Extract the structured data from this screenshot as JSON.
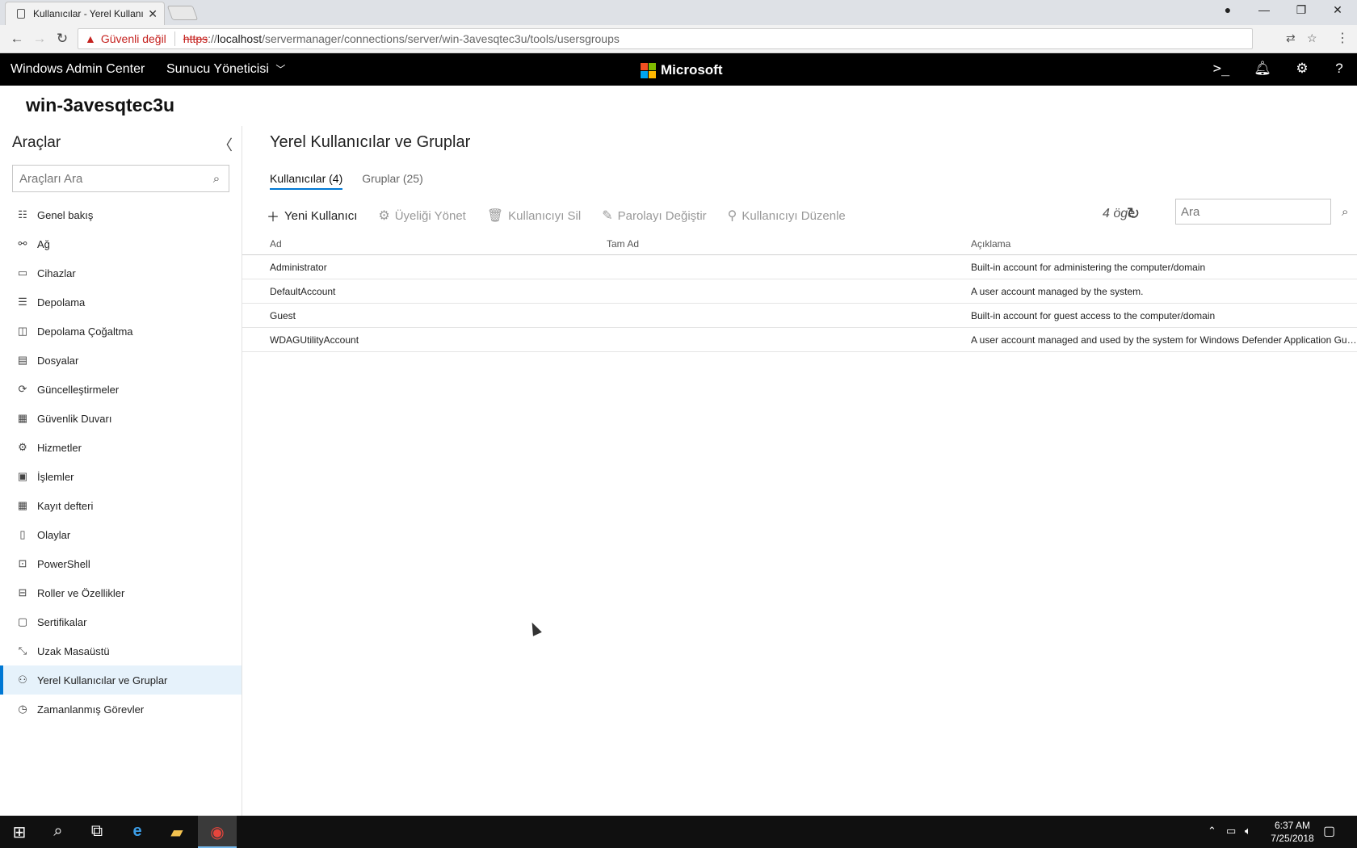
{
  "browser": {
    "tab_title": "Kullanıcılar - Yerel Kullanıcılar ve Gruplar",
    "insecure_label": "Güvenli değil",
    "url_scheme": "https",
    "url_sep": "://",
    "url_host": "localhost",
    "url_path": "/servermanager/connections/server/win-3avesqtec3u/tools/usersgroups"
  },
  "header": {
    "app_name": "Windows Admin Center",
    "context": "Sunucu Yöneticisi",
    "brand": "Microsoft",
    "brand_colors": [
      "#f25022",
      "#7fba00",
      "#00a4ef",
      "#ffb900"
    ]
  },
  "server_name": "win-3avesqtec3u",
  "sidebar": {
    "title": "Araçlar",
    "search_placeholder": "Araçları Ara",
    "items": [
      {
        "label": "Genel bakış",
        "icon": "overview-icon"
      },
      {
        "label": "Ağ",
        "icon": "network-icon"
      },
      {
        "label": "Cihazlar",
        "icon": "devices-icon"
      },
      {
        "label": "Depolama",
        "icon": "storage-icon"
      },
      {
        "label": "Depolama Çoğaltma",
        "icon": "storage-replica-icon"
      },
      {
        "label": "Dosyalar",
        "icon": "files-icon"
      },
      {
        "label": "Güncelleştirmeler",
        "icon": "updates-icon"
      },
      {
        "label": "Güvenlik Duvarı",
        "icon": "firewall-icon"
      },
      {
        "label": "Hizmetler",
        "icon": "services-icon"
      },
      {
        "label": "İşlemler",
        "icon": "processes-icon"
      },
      {
        "label": "Kayıt defteri",
        "icon": "registry-icon"
      },
      {
        "label": "Olaylar",
        "icon": "events-icon"
      },
      {
        "label": "PowerShell",
        "icon": "powershell-icon"
      },
      {
        "label": "Roller ve Özellikler",
        "icon": "roles-icon"
      },
      {
        "label": "Sertifikalar",
        "icon": "certificates-icon"
      },
      {
        "label": "Uzak Masaüstü",
        "icon": "remote-desktop-icon"
      },
      {
        "label": "Yerel Kullanıcılar ve Gruplar",
        "icon": "users-icon",
        "active": true
      },
      {
        "label": "Zamanlanmış Görevler",
        "icon": "scheduled-tasks-icon"
      }
    ]
  },
  "main": {
    "title": "Yerel Kullanıcılar ve Gruplar",
    "tabs": [
      {
        "label": "Kullanıcılar (4)",
        "active": true
      },
      {
        "label": "Gruplar (25)",
        "active": false
      }
    ],
    "toolbar": {
      "new_user": "Yeni Kullanıcı",
      "manage_membership": "Üyeliği Yönet",
      "delete_user": "Kullanıcıyı Sil",
      "change_password": "Parolayı Değiştir",
      "edit_user": "Kullanıcıyı Düzenle"
    },
    "item_count": "4 öge",
    "search_placeholder": "Ara",
    "columns": [
      "Ad",
      "Tam Ad",
      "Açıklama"
    ],
    "rows": [
      {
        "name": "Administrator",
        "full_name": "",
        "description": "Built-in account for administering the computer/domain"
      },
      {
        "name": "DefaultAccount",
        "full_name": "",
        "description": "A user account managed by the system."
      },
      {
        "name": "Guest",
        "full_name": "",
        "description": "Built-in account for guest access to the computer/domain"
      },
      {
        "name": "WDAGUtilityAccount",
        "full_name": "",
        "description": "A user account managed and used by the system for Windows Defender Application Guard scenarios."
      }
    ]
  },
  "taskbar": {
    "time": "6:37 AM",
    "date": "7/25/2018"
  }
}
